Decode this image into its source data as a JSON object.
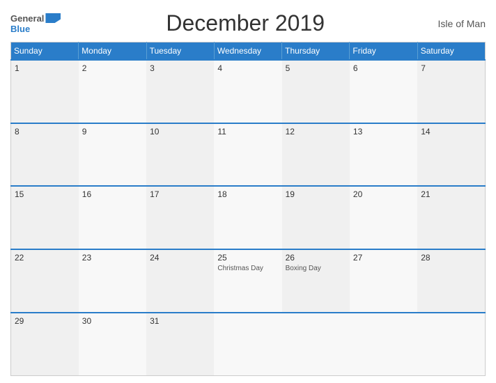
{
  "header": {
    "title": "December 2019",
    "region": "Isle of Man",
    "logo_general": "General",
    "logo_blue": "Blue"
  },
  "calendar": {
    "days_of_week": [
      "Sunday",
      "Monday",
      "Tuesday",
      "Wednesday",
      "Thursday",
      "Friday",
      "Saturday"
    ],
    "weeks": [
      [
        {
          "date": "1",
          "holiday": ""
        },
        {
          "date": "2",
          "holiday": ""
        },
        {
          "date": "3",
          "holiday": ""
        },
        {
          "date": "4",
          "holiday": ""
        },
        {
          "date": "5",
          "holiday": ""
        },
        {
          "date": "6",
          "holiday": ""
        },
        {
          "date": "7",
          "holiday": ""
        }
      ],
      [
        {
          "date": "8",
          "holiday": ""
        },
        {
          "date": "9",
          "holiday": ""
        },
        {
          "date": "10",
          "holiday": ""
        },
        {
          "date": "11",
          "holiday": ""
        },
        {
          "date": "12",
          "holiday": ""
        },
        {
          "date": "13",
          "holiday": ""
        },
        {
          "date": "14",
          "holiday": ""
        }
      ],
      [
        {
          "date": "15",
          "holiday": ""
        },
        {
          "date": "16",
          "holiday": ""
        },
        {
          "date": "17",
          "holiday": ""
        },
        {
          "date": "18",
          "holiday": ""
        },
        {
          "date": "19",
          "holiday": ""
        },
        {
          "date": "20",
          "holiday": ""
        },
        {
          "date": "21",
          "holiday": ""
        }
      ],
      [
        {
          "date": "22",
          "holiday": ""
        },
        {
          "date": "23",
          "holiday": ""
        },
        {
          "date": "24",
          "holiday": ""
        },
        {
          "date": "25",
          "holiday": "Christmas Day"
        },
        {
          "date": "26",
          "holiday": "Boxing Day"
        },
        {
          "date": "27",
          "holiday": ""
        },
        {
          "date": "28",
          "holiday": ""
        }
      ],
      [
        {
          "date": "29",
          "holiday": ""
        },
        {
          "date": "30",
          "holiday": ""
        },
        {
          "date": "31",
          "holiday": ""
        },
        {
          "date": "",
          "holiday": ""
        },
        {
          "date": "",
          "holiday": ""
        },
        {
          "date": "",
          "holiday": ""
        },
        {
          "date": "",
          "holiday": ""
        }
      ]
    ]
  }
}
